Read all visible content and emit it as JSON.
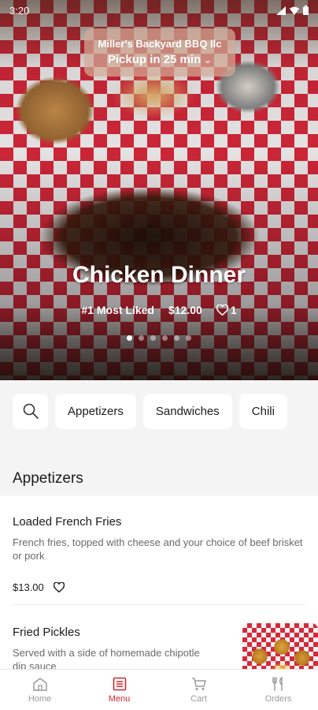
{
  "status_bar": {
    "time": "3:20"
  },
  "hero": {
    "store_name": "Miller's Backyard BBQ llc",
    "pickup_text": "Pickup in 25 min",
    "title": "Chicken Dinner",
    "badge": "#1 Most Liked",
    "price": "$12.00",
    "likes": "1",
    "carousel_total": 6,
    "carousel_active": 1
  },
  "categories": [
    "Appetizers",
    "Sandwiches",
    "Chili"
  ],
  "section": {
    "title": "Appetizers"
  },
  "items": [
    {
      "name": "Loaded French Fries",
      "description": "French fries, topped with cheese and your choice of beef brisket or pork",
      "price": "$13.00"
    },
    {
      "name": "Fried Pickles",
      "description": "Served with a side of homemade chipotle dip sauce"
    }
  ],
  "bottom_nav": [
    {
      "label": "Home",
      "active": false
    },
    {
      "label": "Menu",
      "active": true
    },
    {
      "label": "Cart",
      "active": false
    },
    {
      "label": "Orders",
      "active": false
    }
  ],
  "colors": {
    "accent": "#d22630",
    "inactive": "#9a9a9a"
  }
}
